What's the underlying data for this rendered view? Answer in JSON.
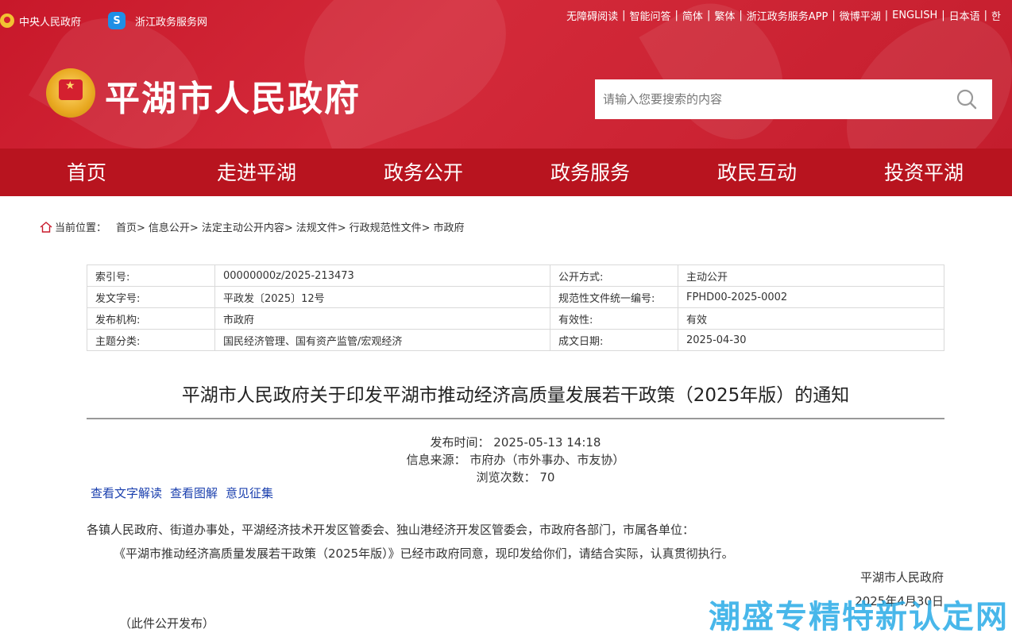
{
  "topbar": {
    "left": [
      {
        "label": "中央人民政府",
        "icon": "national-emblem-icon"
      },
      {
        "label": "浙江政务服务网",
        "icon": "zj-service-icon"
      }
    ],
    "right": [
      "无障碍阅读",
      "智能问答",
      "简体",
      "繁体",
      "浙江政务服务APP",
      "微博平湖",
      "ENGLISH",
      "日本语",
      "한"
    ]
  },
  "site": {
    "title": "平湖市人民政府"
  },
  "search": {
    "placeholder": "请输入您要搜索的内容"
  },
  "nav": [
    "首页",
    "走进平湖",
    "政务公开",
    "政务服务",
    "政民互动",
    "投资平湖"
  ],
  "breadcrumb": {
    "label": "当前位置：",
    "items": [
      "首页>",
      "信息公开>",
      "法定主动公开内容>",
      "法规文件>",
      "行政规范性文件>",
      "市政府"
    ]
  },
  "meta": [
    [
      "索引号:",
      "00000000z/2025-213473",
      "公开方式:",
      "主动公开"
    ],
    [
      "发文字号:",
      "平政发〔2025〕12号",
      "规范性文件统一编号:",
      "FPHD00-2025-0002"
    ],
    [
      "发布机构:",
      "市政府",
      "有效性:",
      "有效"
    ],
    [
      "主题分类:",
      "国民经济管理、国有资产监管/宏观经济",
      "成文日期:",
      "2025-04-30"
    ]
  ],
  "doc": {
    "title": "平湖市人民政府关于印发平湖市推动经济高质量发展若干政策（2025年版）的通知",
    "publish_time": "发布时间：  2025-05-13 14:18",
    "source": "信息来源：  市府办（市外事办、市友协）",
    "views": "浏览次数：  70",
    "links": [
      "查看文字解读",
      "查看图解",
      "意见征集"
    ],
    "recipients": "各镇人民政府、街道办事处，平湖经济技术开发区管委会、独山港经济开发区管委会，市政府各部门，市属各单位：",
    "body": "《平湖市推动经济高质量发展若干政策（2025年版）》已经市政府同意，现印发给你们，请结合实际，认真贯彻执行。",
    "signature": "平湖市人民政府",
    "date": "2025年4月30日",
    "note": "（此件公开发布）"
  },
  "watermark": "潮盛专精特新认定网",
  "colors": {
    "header_red": "#c8182a",
    "nav_red": "#b8141f",
    "link_blue": "#1a3fae",
    "watermark_blue": "#28aae6"
  }
}
